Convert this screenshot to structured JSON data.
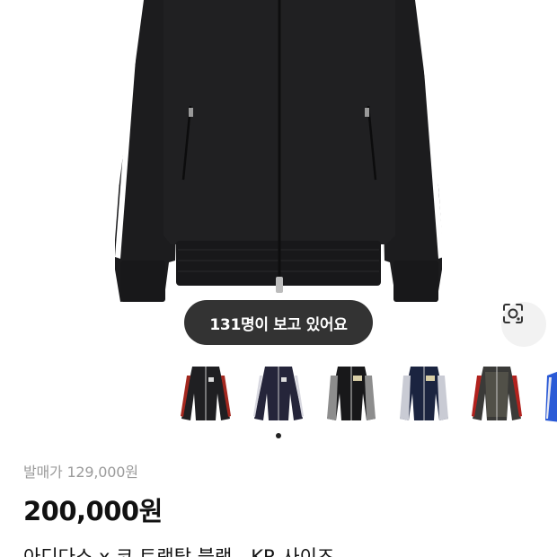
{
  "product": {
    "viewer_count_text": "131명이 보고 있어요",
    "lens_icon": "camera-lens-search-icon",
    "original_price_text": "발매가 129,000원",
    "price_text": "200,000원",
    "title": "아디다스 x 코 트랙탑 블랙 - KR 사이즈"
  },
  "gallery": {
    "thumbnails": [
      {
        "label": "black-red-track-jacket"
      },
      {
        "label": "navy-track-jacket"
      },
      {
        "label": "black-grey-track-jacket"
      },
      {
        "label": "navy-white-track-jacket"
      },
      {
        "label": "patterned-red-track-jacket"
      },
      {
        "label": "blue-track-jacket"
      }
    ],
    "active_index": 0
  },
  "colors": {
    "pill_bg": "#333333",
    "jacket": "#1c1c1e",
    "stripe": "#ffffff"
  }
}
